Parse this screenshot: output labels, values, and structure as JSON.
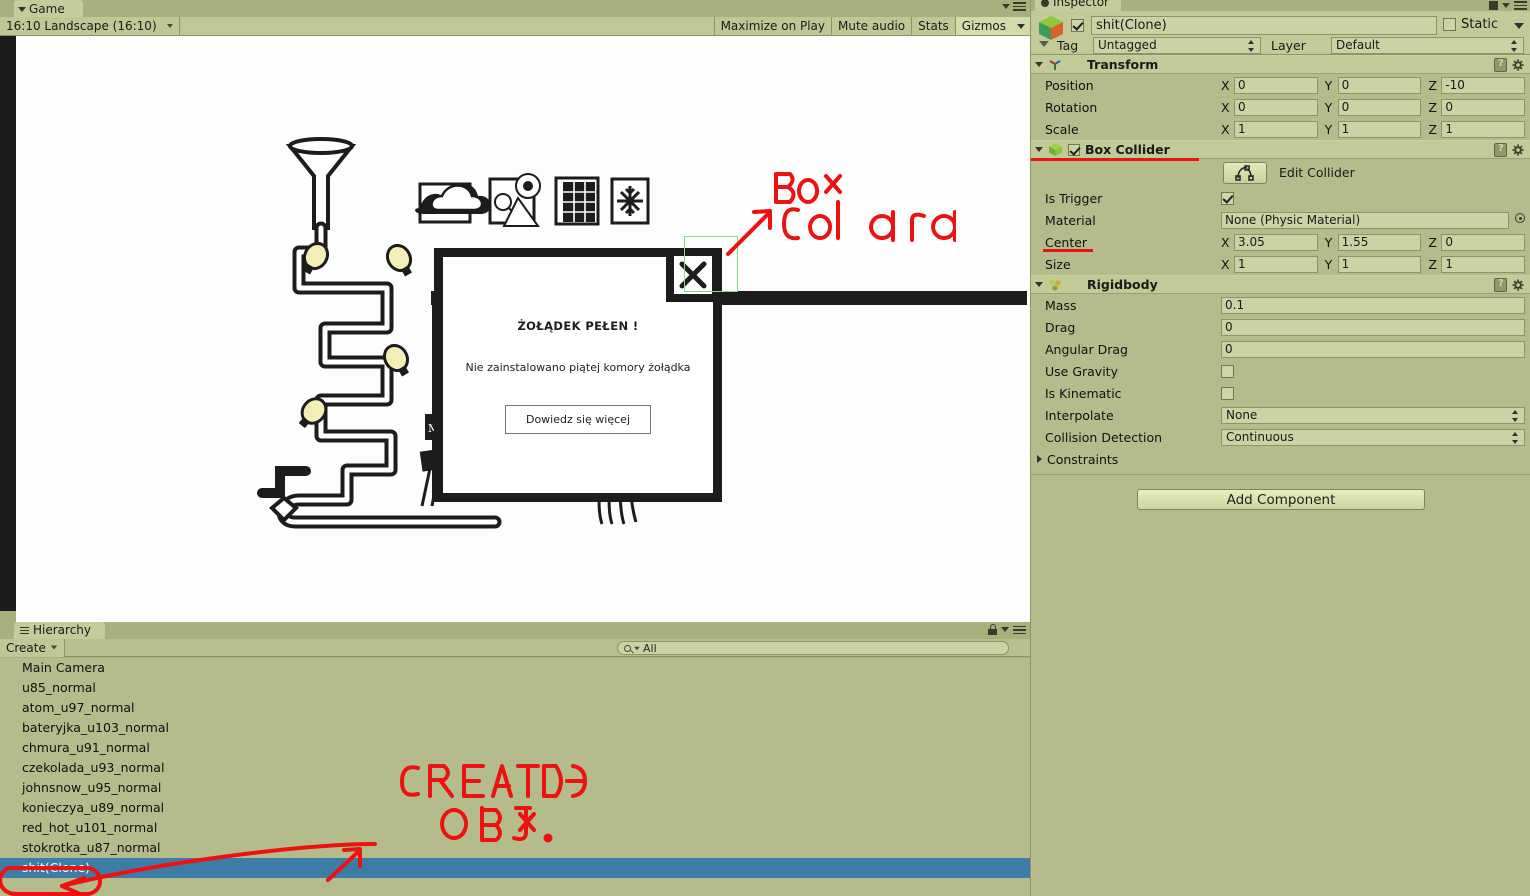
{
  "game_view": {
    "tab_label": "Game",
    "aspect": "16:10 Landscape (16:10)",
    "buttons": [
      {
        "label": "Maximize on Play",
        "pressed": false
      },
      {
        "label": "Mute audio",
        "pressed": false
      },
      {
        "label": "Stats",
        "pressed": false
      },
      {
        "label": "Gizmos",
        "pressed": true
      }
    ],
    "modal": {
      "title": "ŻOŁĄDEK PEŁEN !",
      "body": "Nie zainstalowano piątej komory żołądka",
      "button": "Dowiedz się więcej",
      "close_icon": "close-x-icon"
    }
  },
  "annotations": {
    "box_collider_note_line1": "Box",
    "box_collider_note_line2": "col area",
    "hierarchy_note_line1": "CREATED",
    "hierarchy_note_line2": "OBJ.",
    "color": "#ee1111"
  },
  "hierarchy": {
    "tab_label": "Hierarchy",
    "create_label": "Create",
    "search_value": "All",
    "search_placeholder": "All",
    "items": [
      {
        "label": "Main Camera",
        "selected": false
      },
      {
        "label": "u85_normal",
        "selected": false
      },
      {
        "label": "atom_u97_normal",
        "selected": false
      },
      {
        "label": "bateryjka_u103_normal",
        "selected": false
      },
      {
        "label": "chmura_u91_normal",
        "selected": false
      },
      {
        "label": "czekolada_u93_normal",
        "selected": false
      },
      {
        "label": "johnsnow_u95_normal",
        "selected": false
      },
      {
        "label": "konieczya_u89_normal",
        "selected": false
      },
      {
        "label": "red_hot_u101_normal",
        "selected": false
      },
      {
        "label": "stokrotka_u87_normal",
        "selected": false
      },
      {
        "label": "shit(Clone)",
        "selected": true
      }
    ]
  },
  "inspector": {
    "tab_label": "Inspector",
    "object": {
      "name": "shit(Clone)",
      "enabled": true,
      "static_label": "Static",
      "static_checked": false,
      "tag_label": "Tag",
      "tag_value": "Untagged",
      "layer_label": "Layer",
      "layer_value": "Default"
    },
    "transform": {
      "title": "Transform",
      "rows": [
        {
          "label": "Position",
          "x": "0",
          "y": "0",
          "z": "-10"
        },
        {
          "label": "Rotation",
          "x": "0",
          "y": "0",
          "z": "0"
        },
        {
          "label": "Scale",
          "x": "1",
          "y": "1",
          "z": "1"
        }
      ],
      "axes": {
        "x": "X",
        "y": "Y",
        "z": "Z"
      }
    },
    "box_collider": {
      "title": "Box Collider",
      "enabled": true,
      "edit_collider_label": "Edit Collider",
      "is_trigger_label": "Is Trigger",
      "is_trigger_checked": true,
      "material_label": "Material",
      "material_value": "None (Physic Material)",
      "center": {
        "label": "Center",
        "x": "3.05",
        "y": "1.55",
        "z": "0"
      },
      "size": {
        "label": "Size",
        "x": "1",
        "y": "1",
        "z": "1"
      }
    },
    "rigidbody": {
      "title": "Rigidbody",
      "mass_label": "Mass",
      "mass_value": "0.1",
      "drag_label": "Drag",
      "drag_value": "0",
      "angular_drag_label": "Angular Drag",
      "angular_drag_value": "0",
      "use_gravity_label": "Use Gravity",
      "use_gravity_checked": false,
      "is_kinematic_label": "Is Kinematic",
      "is_kinematic_checked": false,
      "interpolate_label": "Interpolate",
      "interpolate_value": "None",
      "collision_detection_label": "Collision Detection",
      "collision_detection_value": "Continuous",
      "constraints_label": "Constraints"
    },
    "add_component_label": "Add Component"
  },
  "colors": {
    "panel_bg": "#b4bc8b",
    "header_bg": "#c2ca98",
    "field_bg": "#cbd2a4",
    "selection_blue": "#3d7ca6",
    "annotation_red": "#ee1111",
    "selection_green": "#7fe07f"
  }
}
